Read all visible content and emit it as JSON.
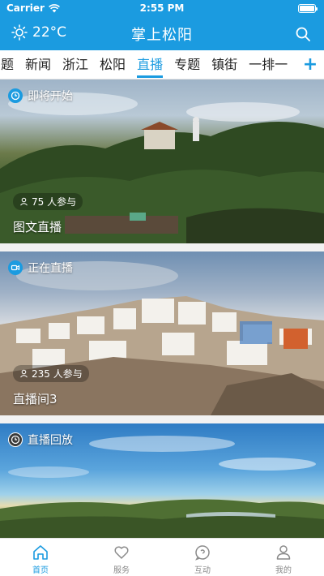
{
  "status_bar": {
    "carrier": "Carrier",
    "time": "2:55 PM"
  },
  "header": {
    "temperature": "22°C",
    "title": "掌上松阳",
    "weather_icon": "sun-icon",
    "search_icon": "search-icon"
  },
  "tabs": {
    "items": [
      "题",
      "新闻",
      "浙江",
      "松阳",
      "直播",
      "专题",
      "镇街",
      "一排一"
    ],
    "active": "直播",
    "add_label": "+"
  },
  "feed": {
    "cards": [
      {
        "status": "即将开始",
        "participants": "75 人参与",
        "title": "图文直播"
      },
      {
        "status": "正在直播",
        "participants": "235 人参与",
        "title": "直播间3"
      },
      {
        "status": "直播回放"
      }
    ]
  },
  "bottom_nav": {
    "items": [
      {
        "label": "首页",
        "icon": "home-icon",
        "active": true
      },
      {
        "label": "服务",
        "icon": "heart-icon",
        "active": false
      },
      {
        "label": "互动",
        "icon": "chat-icon",
        "active": false
      },
      {
        "label": "我的",
        "icon": "user-icon",
        "active": false
      }
    ]
  },
  "colors": {
    "brand": "#1b9be0",
    "inactive": "#8a8a8a"
  }
}
